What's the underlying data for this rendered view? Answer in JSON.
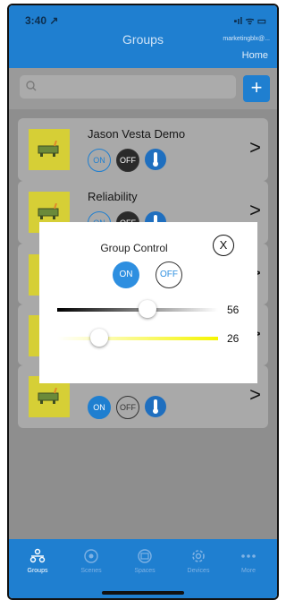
{
  "status": {
    "time": "3:40 ↗",
    "icons": "▪ıl ᯤ ▭"
  },
  "header": {
    "title": "Groups",
    "account": "marketingblx@...",
    "home_link": "Home"
  },
  "search": {
    "placeholder": "",
    "add_label": "+"
  },
  "groups": [
    {
      "name": "Jason Vesta Demo",
      "on": "ON",
      "off": "OFF"
    },
    {
      "name": "Reliability",
      "on": "ON",
      "off": "OFF"
    },
    {
      "name": "",
      "on": "",
      "off": ""
    },
    {
      "name": "",
      "on": "",
      "off": ""
    },
    {
      "name": "",
      "on": "ON",
      "off": "OFF"
    }
  ],
  "modal": {
    "title": "Group Control",
    "close": "X",
    "on_label": "ON",
    "off_label": "OFF",
    "brightness": {
      "value": 56,
      "display": "56"
    },
    "color_temp": {
      "value": 26,
      "display": "26"
    }
  },
  "tabs": [
    {
      "label": "Groups",
      "icon": "groups-icon",
      "active": true
    },
    {
      "label": "Scenes",
      "icon": "scenes-icon",
      "active": false
    },
    {
      "label": "Spaces",
      "icon": "spaces-icon",
      "active": false
    },
    {
      "label": "Devices",
      "icon": "devices-icon",
      "active": false
    },
    {
      "label": "More",
      "icon": "more-icon",
      "active": false
    }
  ],
  "colors": {
    "primary": "#1f7fd0",
    "overlay": "#8e8e8e",
    "thumb": "#d6cf36"
  }
}
